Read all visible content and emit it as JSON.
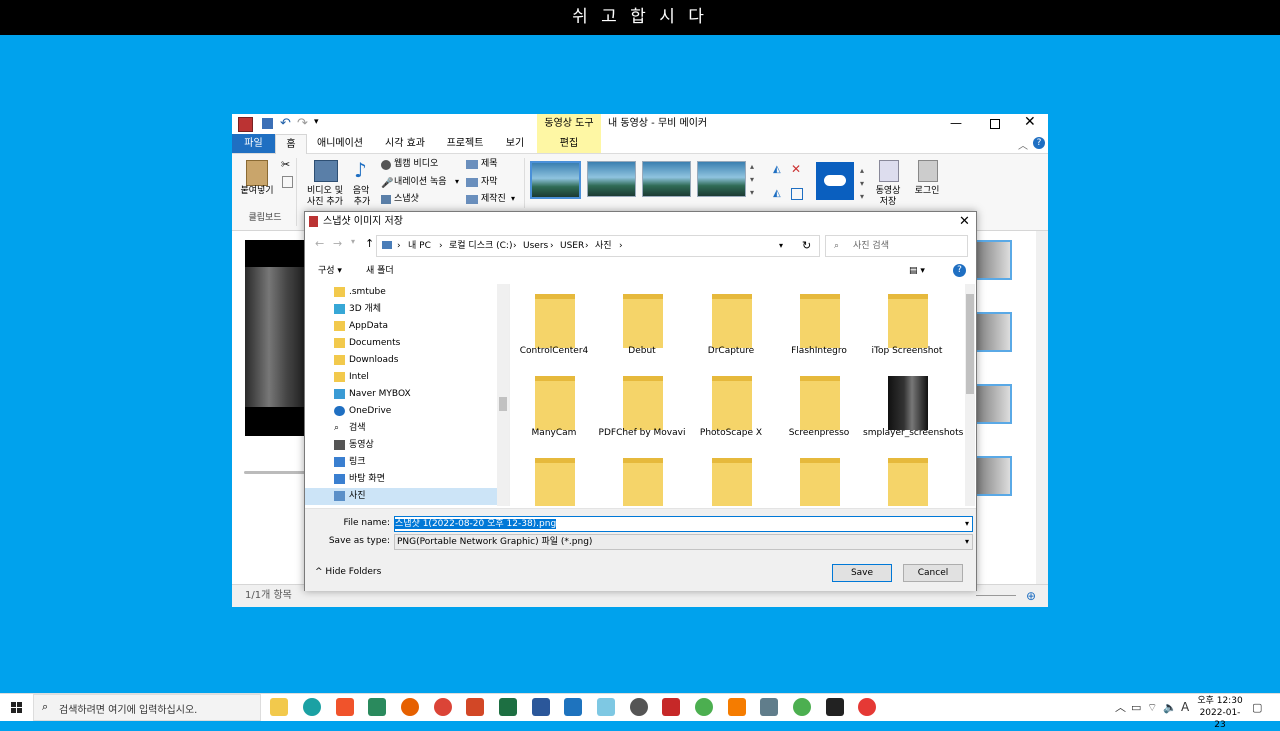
{
  "top_banner": "쉬 고 합 시 다",
  "movie_maker": {
    "window_title": "내 동영상 - 무비 메이커",
    "context_tab": "동영상 도구",
    "tabs": [
      "파일",
      "홈",
      "애니메이션",
      "시각 효과",
      "프로젝트",
      "보기",
      "편집"
    ],
    "ribbon": {
      "paste": "붙여넣기",
      "clipboard_group": "클립보드",
      "add_video_photo_1": "비디오 및",
      "add_video_photo_2": "사진 추가",
      "add_music_1": "음악",
      "add_music_2": "추가",
      "webcam_video": "웹캠 비디오",
      "record_narration": "내레이션 녹음",
      "snapshot": "스냅샷",
      "title": "제목",
      "caption": "자막",
      "credits": "제작진",
      "save_movie_1": "동영상",
      "save_movie_2": "저장",
      "login": "로그인"
    },
    "status": "1/1개 항목"
  },
  "dialog": {
    "title": "스냅샷 이미지 저장",
    "breadcrumb": [
      "내 PC",
      "로컬 디스크 (C:)",
      "Users",
      "USER",
      "사진"
    ],
    "search_placeholder": "사진 검색",
    "organize": "구성",
    "new_folder": "새 폴더",
    "nav_items": [
      ".smtube",
      "3D 개체",
      "AppData",
      "Documents",
      "Downloads",
      "Intel",
      "Naver MYBOX",
      "OneDrive",
      "검색",
      "동영상",
      "링크",
      "바탕 화면",
      "사진"
    ],
    "folders": [
      {
        "name": "ControlCenter4"
      },
      {
        "name": "Debut"
      },
      {
        "name": "DrCapture"
      },
      {
        "name": "FlashIntegro"
      },
      {
        "name": "iTop Screenshot"
      },
      {
        "name": "ManyCam"
      },
      {
        "name": "PDFChef by Movavi"
      },
      {
        "name": "PhotoScape X"
      },
      {
        "name": "Screenpresso"
      },
      {
        "name": "smplayer_screenshots"
      }
    ],
    "file_name_label": "File name:",
    "file_name_value": "스냅샷 1(2022-08-20 오후 12-38).png",
    "save_as_type_label": "Save as type:",
    "save_as_type_value": "PNG(Portable Network Graphic) 파일 (*.png)",
    "hide_folders": "Hide Folders",
    "save_button": "Save",
    "cancel_button": "Cancel"
  },
  "taskbar": {
    "search_placeholder": "검색하려면 여기에 입력하십시오.",
    "time": "오후 12:30",
    "date": "2022-01-23",
    "ime": "A"
  },
  "colors": {
    "desktop": "#00a2ed",
    "accent": "#0078d7",
    "context_tab": "#fef7a4"
  }
}
